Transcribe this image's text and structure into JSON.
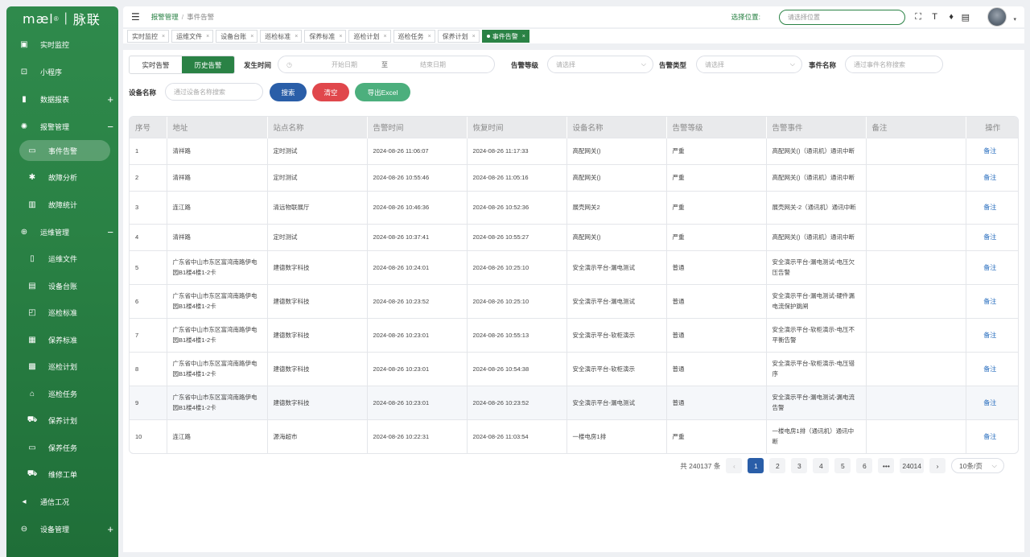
{
  "brand": {
    "logo": "mæl",
    "reg": "®",
    "name": "脉联"
  },
  "sidebar": {
    "items": [
      {
        "label": "实时监控",
        "icon": "image-icon",
        "glyph": "▣"
      },
      {
        "label": "小程序",
        "icon": "miniapp-icon",
        "glyph": "⊡"
      },
      {
        "label": "数据报表",
        "icon": "report-icon",
        "glyph": "▮",
        "toggle": "+"
      },
      {
        "label": "报警管理",
        "icon": "alarm-icon",
        "glyph": "✺",
        "toggle": "−"
      }
    ],
    "alarm_sub": [
      {
        "label": "事件告警",
        "icon": "message-icon",
        "glyph": "▭",
        "active": true
      },
      {
        "label": "故障分析",
        "icon": "bug-icon",
        "glyph": "✱"
      },
      {
        "label": "故障统计",
        "icon": "bar-chart-icon",
        "glyph": "▥"
      }
    ],
    "ops": {
      "label": "运维管理",
      "icon": "globe-icon",
      "glyph": "⊕",
      "toggle": "−"
    },
    "ops_sub": [
      {
        "label": "运维文件",
        "icon": "file-icon",
        "glyph": "▯"
      },
      {
        "label": "设备台账",
        "icon": "ledger-icon",
        "glyph": "▤"
      },
      {
        "label": "巡检标准",
        "icon": "standard-icon",
        "glyph": "◰"
      },
      {
        "label": "保养标准",
        "icon": "maintain-icon",
        "glyph": "▦"
      },
      {
        "label": "巡检计划",
        "icon": "calendar-icon",
        "glyph": "▩"
      },
      {
        "label": "巡检任务",
        "icon": "home-icon",
        "glyph": "⌂"
      },
      {
        "label": "保养计划",
        "icon": "cart-icon",
        "glyph": "⛟"
      },
      {
        "label": "保养任务",
        "icon": "monitor-icon",
        "glyph": "▭"
      },
      {
        "label": "维修工单",
        "icon": "cart2-icon",
        "glyph": "⛟"
      }
    ],
    "bottom": [
      {
        "label": "通信工况",
        "icon": "send-icon",
        "glyph": "◂"
      },
      {
        "label": "设备管理",
        "icon": "device-icon",
        "glyph": "⊖",
        "toggle": "+"
      }
    ]
  },
  "header": {
    "menu_icon": "☰",
    "crumb1": "报警管理",
    "crumb_sep": "/",
    "crumb2": "事件告警",
    "location_label": "选择位置:",
    "location_placeholder": "请选择位置"
  },
  "tabs": [
    {
      "label": "实时监控"
    },
    {
      "label": "运维文件"
    },
    {
      "label": "设备台账"
    },
    {
      "label": "巡检标准"
    },
    {
      "label": "保养标准"
    },
    {
      "label": "巡检计划"
    },
    {
      "label": "巡检任务"
    },
    {
      "label": "保养计划"
    },
    {
      "label": "事件告警",
      "active": true
    }
  ],
  "filters": {
    "seg_realtime": "实时告警",
    "seg_history": "历史告警",
    "time_label": "发生时间",
    "start_placeholder": "开始日期",
    "to": "至",
    "end_placeholder": "结束日期",
    "level_label": "告警等级",
    "level_placeholder": "请选择",
    "type_label": "告警类型",
    "type_placeholder": "请选择",
    "event_label": "事件名称",
    "event_placeholder": "通过事件名称搜索",
    "device_label": "设备名称",
    "device_placeholder": "通过设备名称搜索",
    "search_btn": "搜索",
    "clear_btn": "清空",
    "export_btn": "导出Excel",
    "colors": {
      "search": "#2a5ea8",
      "clear": "#e0474c",
      "export": "#4caf7d"
    }
  },
  "table": {
    "headers": [
      "序号",
      "地址",
      "站点名称",
      "告警时间",
      "恢复时间",
      "设备名称",
      "告警等级",
      "告警事件",
      "备注",
      "操作"
    ],
    "rows": [
      [
        "1",
        "清祥路",
        "定时测试",
        "2024-08-26 11:06:07",
        "2024-08-26 11:17:33",
        "高配网关()",
        "严重",
        "高配网关()（通讯机）通讯中断",
        "",
        "备注"
      ],
      [
        "2",
        "清祥路",
        "定时测试",
        "2024-08-26 10:55:46",
        "2024-08-26 11:05:16",
        "高配网关()",
        "严重",
        "高配网关()（通讯机）通讯中断",
        "",
        "备注"
      ],
      [
        "3",
        "连江路",
        "清远物联展厅",
        "2024-08-26 10:46:36",
        "2024-08-26 10:52:36",
        "展壳网关2",
        "严重",
        "展壳网关-2（通讯机）通讯中断",
        "",
        "备注"
      ],
      [
        "4",
        "清祥路",
        "定时测试",
        "2024-08-26 10:37:41",
        "2024-08-26 10:55:27",
        "高配网关()",
        "严重",
        "高配网关()（通讯机）通讯中断",
        "",
        "备注"
      ],
      [
        "5",
        "广东省中山市东区富湾南路伊电园B1楼4楼1-2卡",
        "建德数字科技",
        "2024-08-26 10:24:01",
        "2024-08-26 10:25:10",
        "安全演示平台-漏电测试",
        "普通",
        "安全演示平台-漏电测试-电压欠压告警",
        "",
        "备注"
      ],
      [
        "6",
        "广东省中山市东区富湾南路伊电园B1楼4楼1-2卡",
        "建德数字科技",
        "2024-08-26 10:23:52",
        "2024-08-26 10:25:10",
        "安全演示平台-漏电测试",
        "普通",
        "安全演示平台-漏电测试-硬件漏电流保护跳闸",
        "",
        "备注"
      ],
      [
        "7",
        "广东省中山市东区富湾南路伊电园B1楼4楼1-2卡",
        "建德数字科技",
        "2024-08-26 10:23:01",
        "2024-08-26 10:55:13",
        "安全演示平台-软柜演示",
        "普通",
        "安全演示平台-软柜演示-电压不平衡告警",
        "",
        "备注"
      ],
      [
        "8",
        "广东省中山市东区富湾南路伊电园B1楼4楼1-2卡",
        "建德数字科技",
        "2024-08-26 10:23:01",
        "2024-08-26 10:54:38",
        "安全演示平台-软柜演示",
        "普通",
        "安全演示平台-软柜演示-电压错序",
        "",
        "备注"
      ],
      [
        "9",
        "广东省中山市东区富湾南路伊电园B1楼4楼1-2卡",
        "建德数字科技",
        "2024-08-26 10:23:01",
        "2024-08-26 10:23:52",
        "安全演示平台-漏电测试",
        "普通",
        "安全演示平台-漏电测试-漏电流告警",
        "",
        "备注"
      ],
      [
        "10",
        "连江路",
        "源海超市",
        "2024-08-26 10:22:31",
        "2024-08-26 11:03:54",
        "一楼电房1排",
        "严重",
        "一楼电房1排（通讯机）通讯中断",
        "",
        "备注"
      ]
    ]
  },
  "pager": {
    "total": "共 240137 条",
    "prev": "‹",
    "pages": [
      "1",
      "2",
      "3",
      "4",
      "5",
      "6",
      "•••",
      "24014"
    ],
    "next": "›",
    "size": "10条/页"
  }
}
